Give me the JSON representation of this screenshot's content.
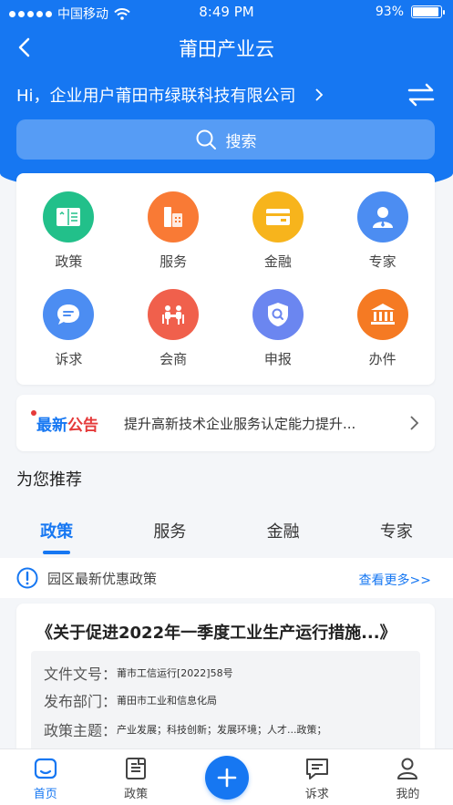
{
  "status_bar": {
    "carrier": "中国移动",
    "time": "8:49 PM",
    "battery": "93%",
    "battery_level": 0.93
  },
  "nav": {
    "title": "莆田产业云"
  },
  "greeting": {
    "text": "Hi，企业用户莆田市绿联科技有限公司"
  },
  "search": {
    "label": "搜索"
  },
  "services": [
    {
      "label": "政策",
      "icon": "policy-icon",
      "color": "#22c08a"
    },
    {
      "label": "服务",
      "icon": "service-icon",
      "color": "#f97a35"
    },
    {
      "label": "金融",
      "icon": "finance-icon",
      "color": "#f7b41c"
    },
    {
      "label": "专家",
      "icon": "expert-icon",
      "color": "#4c8df2"
    },
    {
      "label": "诉求",
      "icon": "appeal-icon",
      "color": "#4c8df2"
    },
    {
      "label": "会商",
      "icon": "meeting-icon",
      "color": "#f0604c"
    },
    {
      "label": "申报",
      "icon": "declare-icon",
      "color": "#6b86f0"
    },
    {
      "label": "办件",
      "icon": "office-icon",
      "color": "#f57a23"
    }
  ],
  "notice": {
    "badge_a": "最新",
    "badge_b": "公告",
    "text": "提升高新技术企业服务认定能力提升..."
  },
  "recommend": {
    "title": "为您推荐"
  },
  "tabs": [
    "政策",
    "服务",
    "金融",
    "专家"
  ],
  "policy_bar": {
    "label": "园区最新优惠政策",
    "more": "查看更多>>"
  },
  "doc": {
    "title": "《关于促进2022年一季度工业生产运行措施...》",
    "rows": [
      {
        "key": "文件文号：",
        "value": "莆市工信运行[2022]58号"
      },
      {
        "key": "发布部门：",
        "value": "莆田市工业和信息化局"
      },
      {
        "key": "政策主题：",
        "value": "产业发展；科技创新；发展环境；人才...政策；"
      }
    ]
  },
  "tabbar": {
    "home": "首页",
    "policy": "政策",
    "appeal": "诉求",
    "mine": "我的"
  },
  "colors": {
    "primary": "#1677f2",
    "red": "#e53a3a"
  }
}
